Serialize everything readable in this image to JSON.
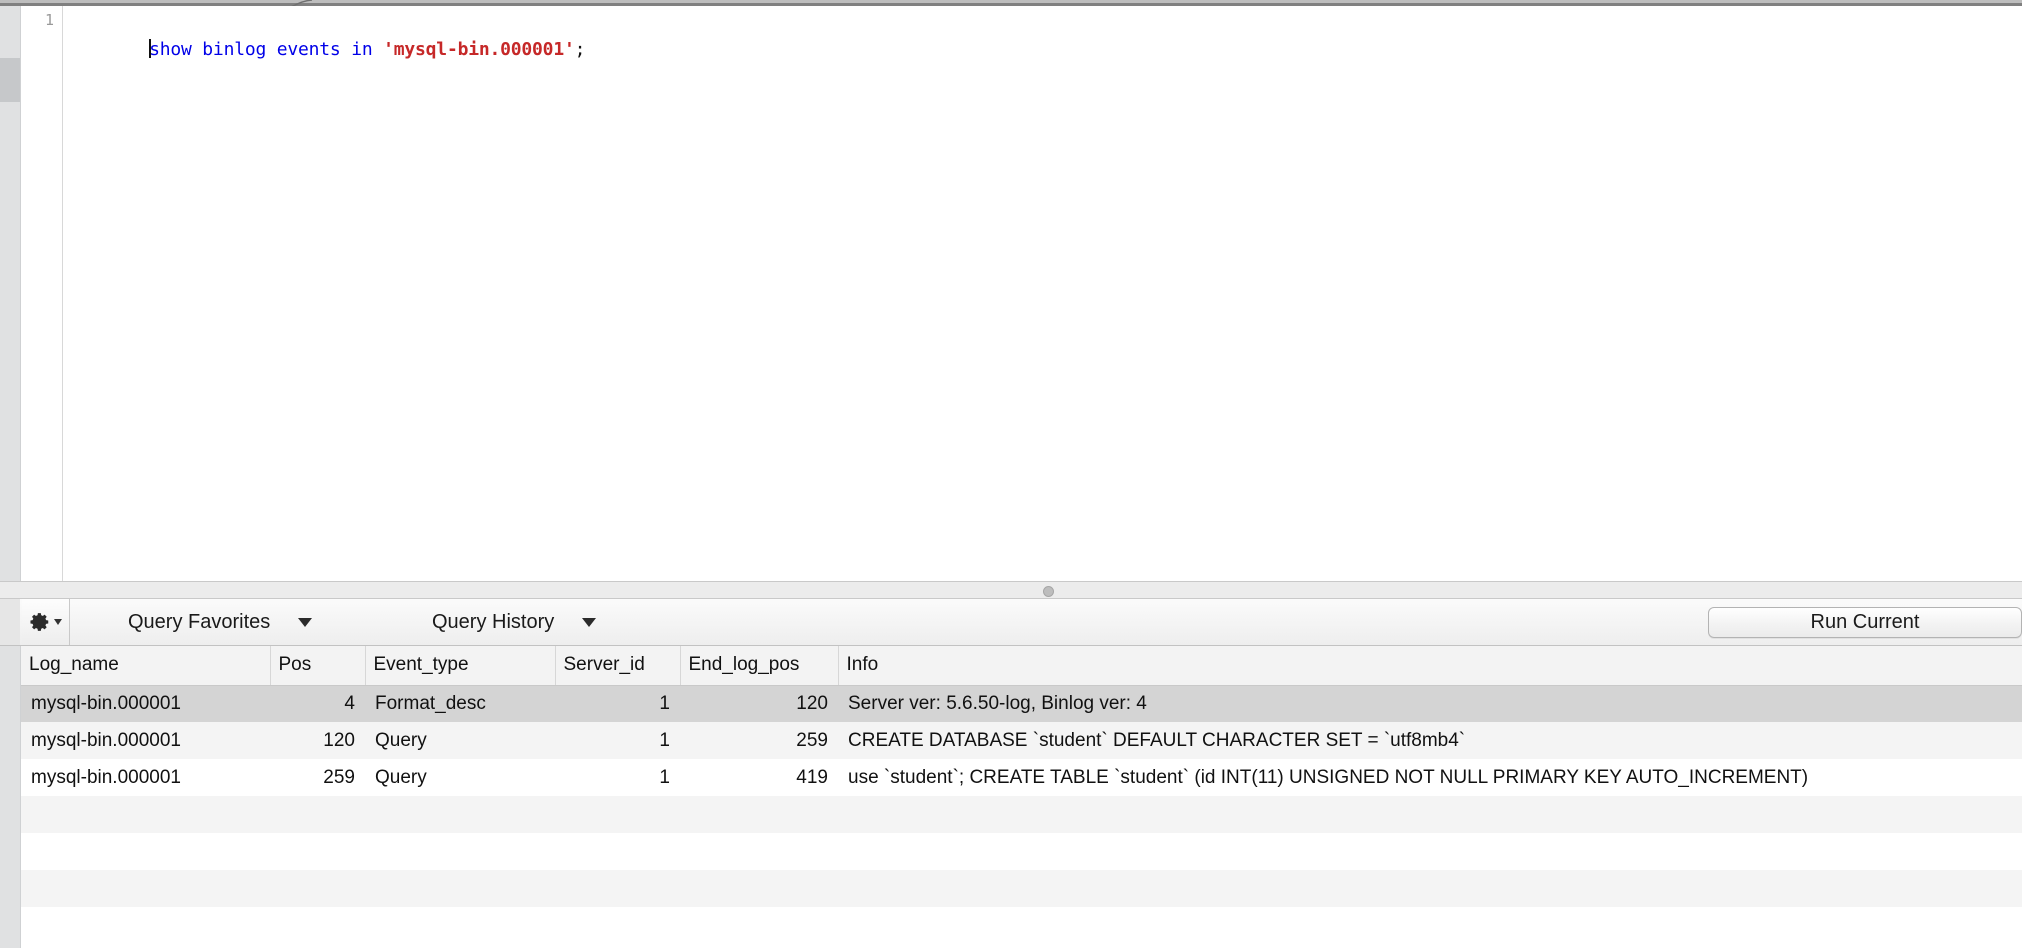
{
  "editor": {
    "line_number": "1",
    "tokens": [
      {
        "t": "show binlog events in ",
        "cls": "kw"
      },
      {
        "t": "'mysql-bin.000001'",
        "cls": "str"
      },
      {
        "t": ";",
        "cls": "punc"
      }
    ],
    "full_text": "show binlog events in 'mysql-bin.000001';"
  },
  "toolbar": {
    "gear_icon": "gear-icon",
    "gear_caret_icon": "caret-down-icon",
    "query_favorites_label": "Query Favorites",
    "query_history_label": "Query History",
    "favorites_chevron_icon": "chevron-down-icon",
    "history_chevron_icon": "chevron-down-icon",
    "run_current_label": "Run Current"
  },
  "splitter": {
    "knob_icon": "resize-handle-icon"
  },
  "results": {
    "columns": [
      "Log_name",
      "Pos",
      "Event_type",
      "Server_id",
      "End_log_pos",
      "Info"
    ],
    "rows": [
      {
        "Log_name": "mysql-bin.000001",
        "Pos": "4",
        "Event_type": "Format_desc",
        "Server_id": "1",
        "End_log_pos": "120",
        "Info": "Server ver: 5.6.50-log, Binlog ver: 4",
        "selected": true
      },
      {
        "Log_name": "mysql-bin.000001",
        "Pos": "120",
        "Event_type": "Query",
        "Server_id": "1",
        "End_log_pos": "259",
        "Info": "CREATE DATABASE `student` DEFAULT CHARACTER SET = `utf8mb4`",
        "selected": false
      },
      {
        "Log_name": "mysql-bin.000001",
        "Pos": "259",
        "Event_type": "Query",
        "Server_id": "1",
        "End_log_pos": "419",
        "Info": "use `student`; CREATE TABLE `student` (id INT(11) UNSIGNED NOT NULL PRIMARY KEY AUTO_INCREMENT)",
        "selected": false
      }
    ],
    "empty_row_count": 4
  },
  "colors": {
    "keyword": "#0000e8",
    "string": "#c62828",
    "selected_row": "#d4d4d4",
    "stripe_row": "#f4f4f4",
    "toolbar_bg": "#eeeeee"
  }
}
